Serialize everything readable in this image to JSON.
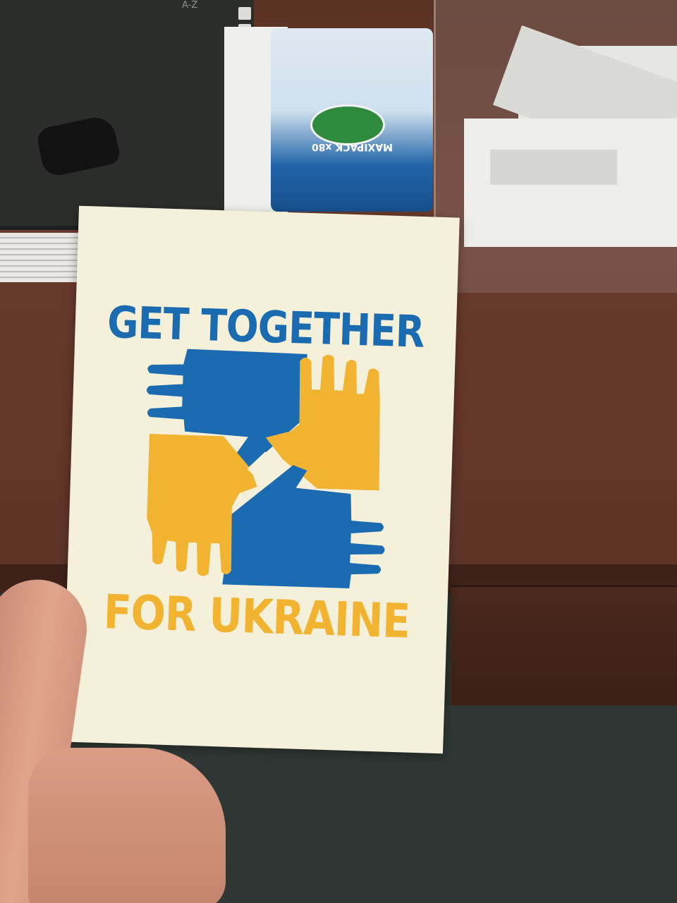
{
  "card": {
    "title_top": "GET TOGETHER",
    "title_bottom": "FOR UKRAINE",
    "colors": {
      "blue": "#1a6bb0",
      "yellow": "#f2b330",
      "card": "#f4f0da"
    },
    "emblem": "four-hands-linked-icon"
  },
  "background": {
    "binder_label": "A-Z",
    "wipes_text": "MAXIPACK x80"
  }
}
